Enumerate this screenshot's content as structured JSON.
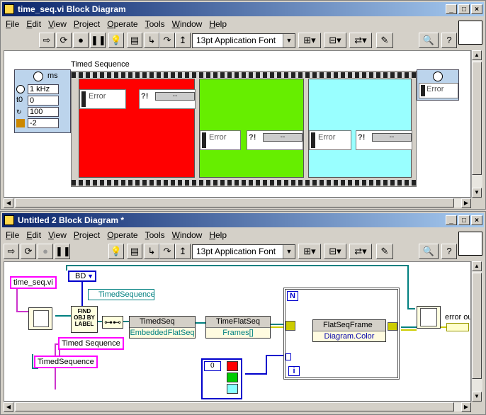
{
  "window1": {
    "title": "time_seq.vi Block Diagram",
    "menu": [
      "File",
      "Edit",
      "View",
      "Project",
      "Operate",
      "Tools",
      "Window",
      "Help"
    ],
    "font_selector": "13pt Application Font",
    "diagram": {
      "seq_label": "Timed Sequence",
      "input_node_unit": "ms",
      "input_fields": [
        {
          "label": "",
          "value": "1 kHz"
        },
        {
          "label": "t0",
          "value": "0"
        },
        {
          "label": "",
          "value": "100"
        },
        {
          "label": "",
          "value": "-2"
        }
      ],
      "frame_colors": [
        "#ff0000",
        "#66ee00",
        "#99ffff"
      ],
      "error_label": "Error",
      "status_value": "--",
      "out_error_label": "Error"
    }
  },
  "window2": {
    "title": "Untitled 2 Block Diagram *",
    "menu": [
      "File",
      "Edit",
      "View",
      "Project",
      "Operate",
      "Tools",
      "Window",
      "Help"
    ],
    "font_selector": "13pt Application Font",
    "diagram": {
      "vi_ref_label": "time_seq.vi",
      "enum_value": "BD",
      "class_constant": "TimedSequence",
      "find_obj_text": "FIND OBJ BY LABEL",
      "label_const_1": "Timed Sequence",
      "label_const_2": "TimedSequence",
      "prop1_class": "TimedSeq",
      "prop1_value": "EmbeddedFlatSeq",
      "prop2_class": "TimeFlatSeq",
      "prop2_value": "Frames[]",
      "prop3_class": "FlatSeqFrame",
      "prop3_value": "Diagram.Color",
      "loop_count_label": "N",
      "loop_index_label": "i",
      "array_index": "0",
      "array_colors": [
        "#ff0000",
        "#00cc00",
        "#88ffff"
      ],
      "error_out_label": "error out"
    }
  }
}
